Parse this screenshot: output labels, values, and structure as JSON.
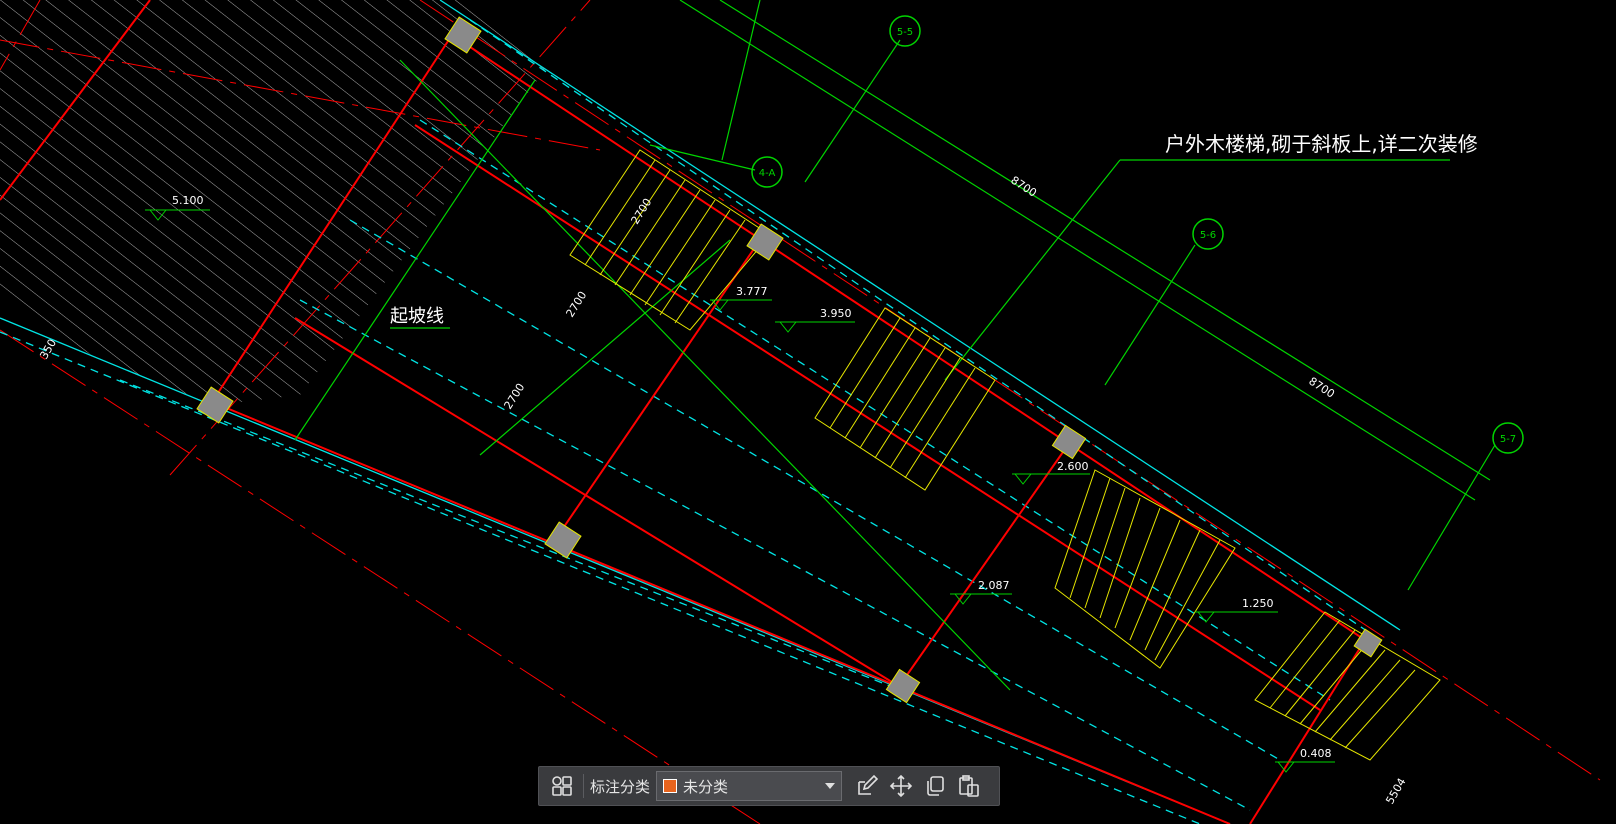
{
  "drawing": {
    "colors": {
      "background": "#000000",
      "beam_red": "#ff0000",
      "edge_cyan": "#00e5e5",
      "annot_green": "#00d400",
      "stair_yellow": "#e6e600",
      "hatch_white": "#c8c8c8",
      "column_gray": "#8a8a8a"
    },
    "annotations": {
      "note": "户外木楼梯,砌于斜板上,详二次装修",
      "slope_line": "起坡线"
    },
    "axis_labels": {
      "a1": "5-5",
      "a2": "4-A",
      "a3": "5-6",
      "a4": "5-7"
    },
    "elevations": {
      "e1": "5.100",
      "e2": "3.777",
      "e3": "3.950",
      "e4": "2.600",
      "e5": "2.087",
      "e6": "1.250",
      "e7": "0.408"
    },
    "dimensions": {
      "d1": "2700",
      "d2": "2700",
      "d3": "2700",
      "d4": "8700",
      "d5": "8700",
      "d6": "350",
      "d7": "5504"
    }
  },
  "toolbar": {
    "category_label": "标注分类",
    "category_value": "未分类",
    "swatch_color": "#e8641e",
    "icons": [
      "grid-icon",
      "edit-icon",
      "move-icon",
      "copy-icon",
      "paste-icon"
    ]
  }
}
